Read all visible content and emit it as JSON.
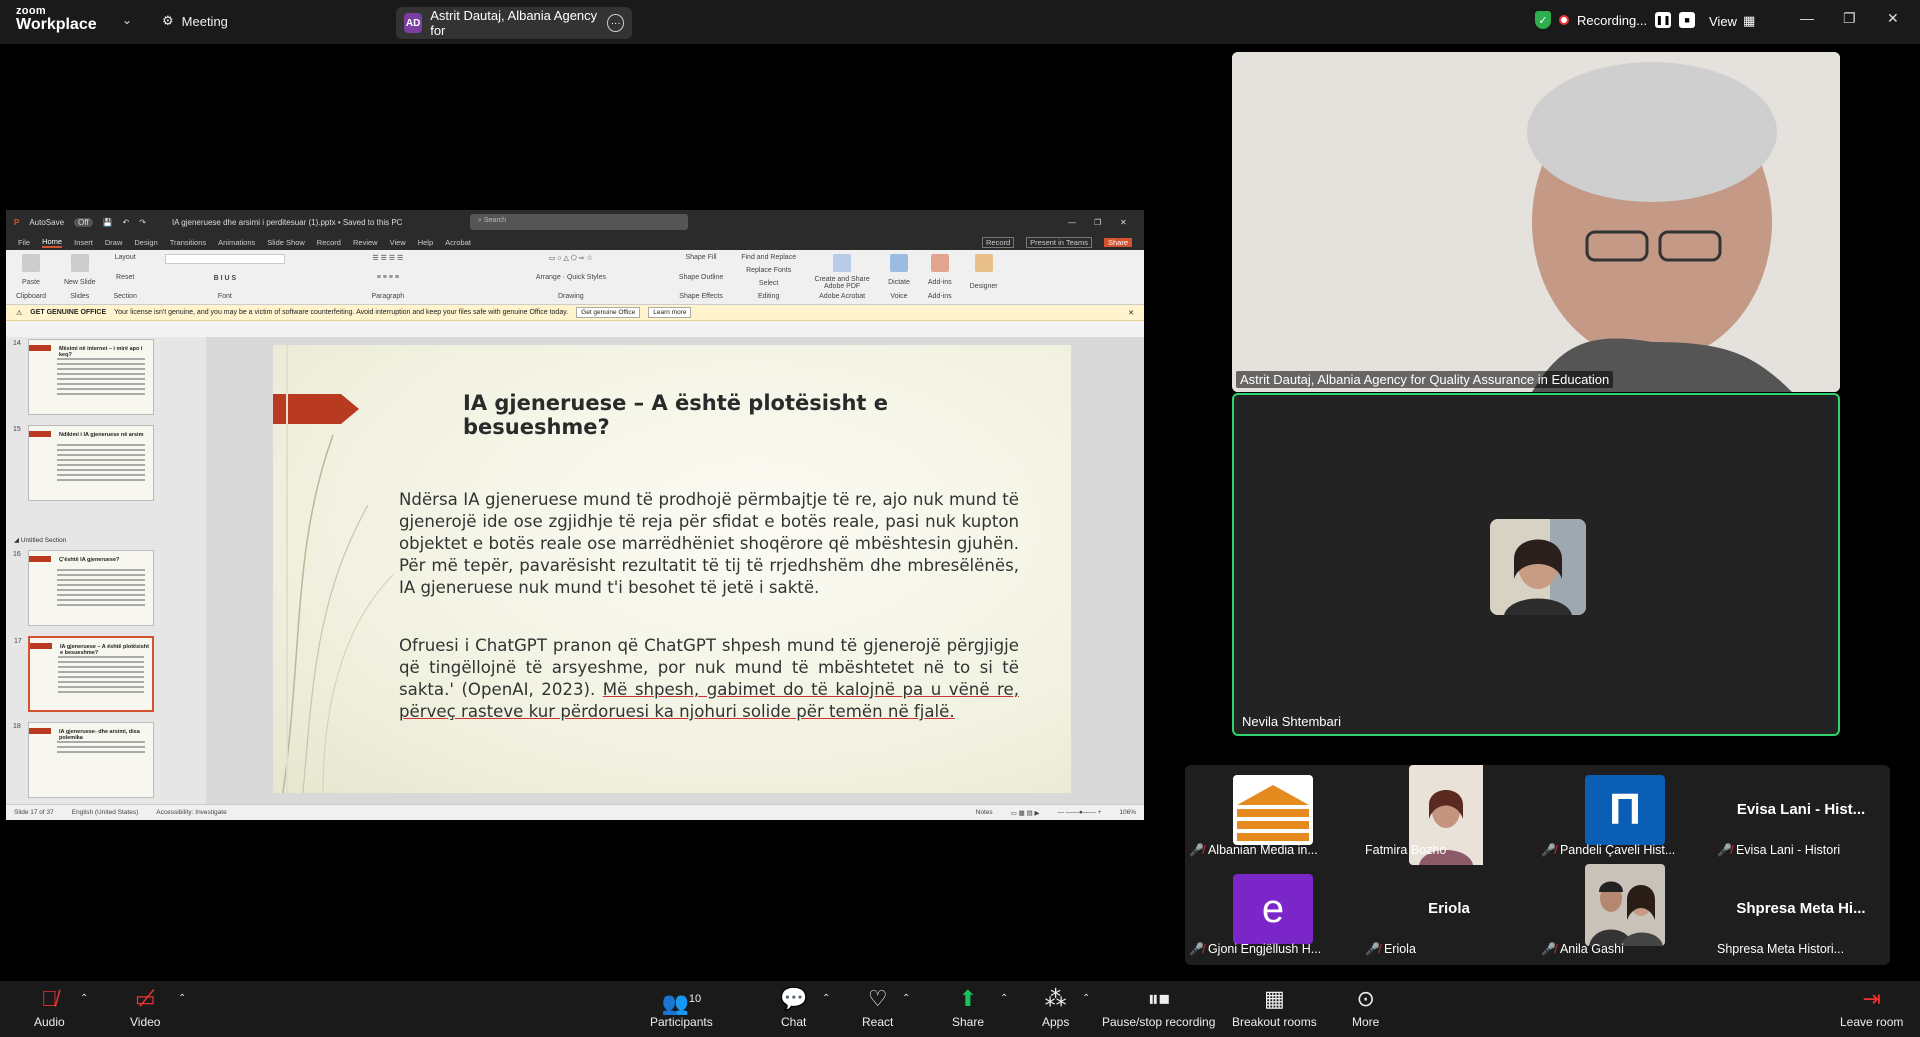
{
  "app": {
    "logo_line1": "zoom",
    "logo_line2": "Workplace",
    "meeting_label": "Meeting"
  },
  "share_pill": {
    "initials": "AD",
    "label": "Astrit Dautaj, Albania Agency for"
  },
  "recording": {
    "label": "Recording..."
  },
  "view": {
    "label": "View"
  },
  "ppt": {
    "autosave": "AutoSave",
    "toggle": "Off",
    "filename": "IA gjeneruese dhe arsimi i perditesuar (1).pptx • Saved to this PC",
    "search_placeholder": "Search",
    "tabs": [
      "File",
      "Home",
      "Insert",
      "Draw",
      "Design",
      "Transitions",
      "Animations",
      "Slide Show",
      "Record",
      "Review",
      "View",
      "Help",
      "Acrobat"
    ],
    "right_buttons": [
      "Record",
      "Present in Teams",
      "Share"
    ],
    "ribbon_groups": [
      "Clipboard",
      "Slides",
      "Font",
      "Paragraph",
      "Drawing",
      "Editing",
      "Adobe Acrobat",
      "Voice",
      "Add-ins"
    ],
    "ribbon_items": [
      "Paste",
      "New Slide",
      "Layout",
      "Reset",
      "Section",
      "Arrange",
      "Quick Styles",
      "Shape Fill",
      "Shape Outline",
      "Shape Effects",
      "Find and Replace",
      "Replace Fonts",
      "Select",
      "Create and Share Adobe PDF",
      "Dictate",
      "Add-ins",
      "Designer"
    ],
    "warning": {
      "title": "GET GENUINE OFFICE",
      "text": "Your license isn't genuine, and you may be a victim of software counterfeiting. Avoid interruption and keep your files safe with genuine Office today.",
      "btn1": "Get genuine Office",
      "btn2": "Learn more"
    },
    "thumbs": [
      {
        "num": "14",
        "title": "Mësimi në internet – i mirë apo i keq?"
      },
      {
        "num": "15",
        "title": "Ndikimi i IA gjeneruese në arsim"
      },
      {
        "num": "16",
        "title": "Ç'është IA gjeneruese?"
      },
      {
        "num": "17",
        "title": "IA gjeneruese – A është plotësisht e besueshme?"
      },
      {
        "num": "18",
        "title": "IA gjeneruese- dhe arsimi, disa polemika"
      }
    ],
    "section_label": "Untitled Section",
    "slide": {
      "title": "IA gjeneruese – A është plotësisht e besueshme?",
      "p1": "Ndërsa IA gjeneruese  mund të prodhojë përmbajtje të re, ajo nuk mund të gjenerojë ide ose zgjidhje të reja për sfidat e botës reale, pasi nuk kupton objektet e botës reale ose marrëdhëniet shoqërore që mbështesin gjuhën. Për më tepër, pavarësisht rezultatit të tij të rrjedhshëm dhe mbresëlënës, IA gjeneruese  nuk mund t'i besohet të jetë i saktë.",
      "p2a": "Ofruesi i ChatGPT pranon që ChatGPT shpesh mund të gjenerojë përgjigje që tingëllojnë të arsyeshme, por nuk mund të mbështetet në to si të sakta.' (OpenAI, 2023). ",
      "p2b": "Më shpesh, gabimet do të kalojnë pa u vënë re, përveç rasteve kur përdoruesi ka njohuri solide për temën në fjalë."
    },
    "status": {
      "slide": "Slide 17 of 37",
      "lang": "English (United States)",
      "access": "Accessibility: Investigate",
      "notes": "Notes",
      "zoom": "106%"
    }
  },
  "tiles": [
    {
      "name": "Astrit Dautaj, Albania Agency for Quality Assurance in Education"
    },
    {
      "name": "Nevila Shtembari"
    }
  ],
  "gallery": [
    {
      "name": "Albanian Media in...",
      "muted": true,
      "kind": "logo-orange"
    },
    {
      "name": "Fatmira  Bozho",
      "muted": false,
      "kind": "photo"
    },
    {
      "name": "Pandeli Çaveli Hist...",
      "muted": true,
      "kind": "logo-blue",
      "glyph": "Π"
    },
    {
      "name": "Evisa Lani - Histori",
      "muted": true,
      "kind": "text",
      "display": "Evisa Lani - Hist..."
    },
    {
      "name": "Gjoni Engjëllush H...",
      "muted": true,
      "kind": "letter",
      "glyph": "e"
    },
    {
      "name": "Eriola",
      "muted": true,
      "kind": "text",
      "display": "Eriola"
    },
    {
      "name": "Anila Gashi",
      "muted": true,
      "kind": "photo2"
    },
    {
      "name": "Shpresa Meta Histori...",
      "muted": false,
      "kind": "text",
      "display": "Shpresa  Meta  Hi..."
    }
  ],
  "toolbar": {
    "audio": "Audio",
    "video": "Video",
    "participants": "Participants",
    "participants_count": "10",
    "chat": "Chat",
    "react": "React",
    "share": "Share",
    "apps": "Apps",
    "pause": "Pause/stop recording",
    "breakout": "Breakout rooms",
    "more": "More",
    "leave": "Leave room"
  },
  "colors": {
    "accent_green": "#2fd36d",
    "share_green": "#19c15a",
    "ppt_accent": "#d35230",
    "muted_red": "#e33333"
  }
}
